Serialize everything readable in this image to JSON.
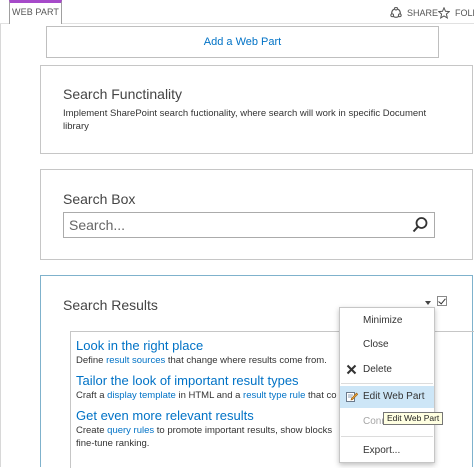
{
  "ribbon": {
    "active_tab": "WEB PART",
    "share_label": "SHARE",
    "follow_label": "FOLLO"
  },
  "add_web_part_label": "Add a Web Part",
  "web_parts": {
    "search_functionality": {
      "title": "Search Functinality",
      "description": "Implement SharePoint search fuctionality, where search will work in specific Document library"
    },
    "search_box": {
      "title": "Search Box",
      "placeholder": "Search..."
    },
    "search_results": {
      "title": "Search Results",
      "tips": [
        {
          "title": "Look in the right place",
          "text_before": "Define ",
          "link1": "result sources",
          "text_mid": " that change where results come from.",
          "link2": "",
          "text_after": ""
        },
        {
          "title": "Tailor the look of important result types",
          "text_before": "Craft a ",
          "link1": "display template",
          "text_mid": " in HTML and a ",
          "link2": "result type rule",
          "text_after": " that co"
        },
        {
          "title": "Get even more relevant results",
          "text_before": "Create ",
          "link1": "query rules",
          "text_mid": " to promote important results, show blocks",
          "link2": "",
          "text_after": "",
          "text_line2": "fine-tune ranking."
        }
      ]
    }
  },
  "context_menu": {
    "items": [
      {
        "label": "Minimize",
        "state": "normal"
      },
      {
        "label": "Close",
        "state": "normal"
      },
      {
        "label": "Delete",
        "state": "normal"
      },
      {
        "label": "Edit Web Part",
        "state": "hover"
      },
      {
        "label": "Conn",
        "state": "disabled"
      },
      {
        "label": "Export...",
        "state": "normal"
      }
    ],
    "tooltip": "Edit Web Part"
  },
  "colors": {
    "link": "#0072c6",
    "ribbon_accent": "#a64ac9",
    "menu_hover": "#cde6f7",
    "selected_zone_border": "#7fb2cc"
  }
}
